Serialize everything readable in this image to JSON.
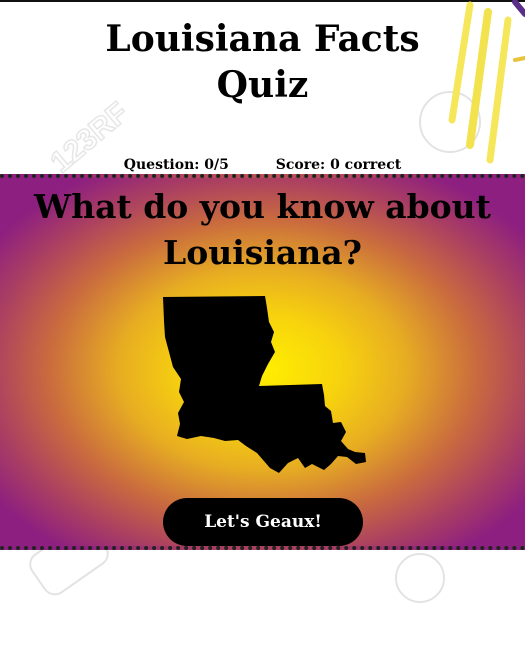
{
  "header": {
    "title_line1": "Louisiana Facts",
    "title_line2": "Quiz"
  },
  "stats": {
    "question": "Question: 0/5",
    "score": "Score: 0 correct"
  },
  "panel": {
    "question_line1": "What do you know about",
    "question_line2": "Louisiana?",
    "state_icon": "louisiana-map-silhouette",
    "start_button_label": "Let's Geaux!"
  },
  "colors": {
    "panel_center": "#ffef00",
    "panel_edge": "#8d1f80",
    "button_bg": "#000000",
    "button_text": "#ffffff",
    "decoration_yellow": "#f5e65a",
    "decoration_purple": "#5b2d8a"
  }
}
